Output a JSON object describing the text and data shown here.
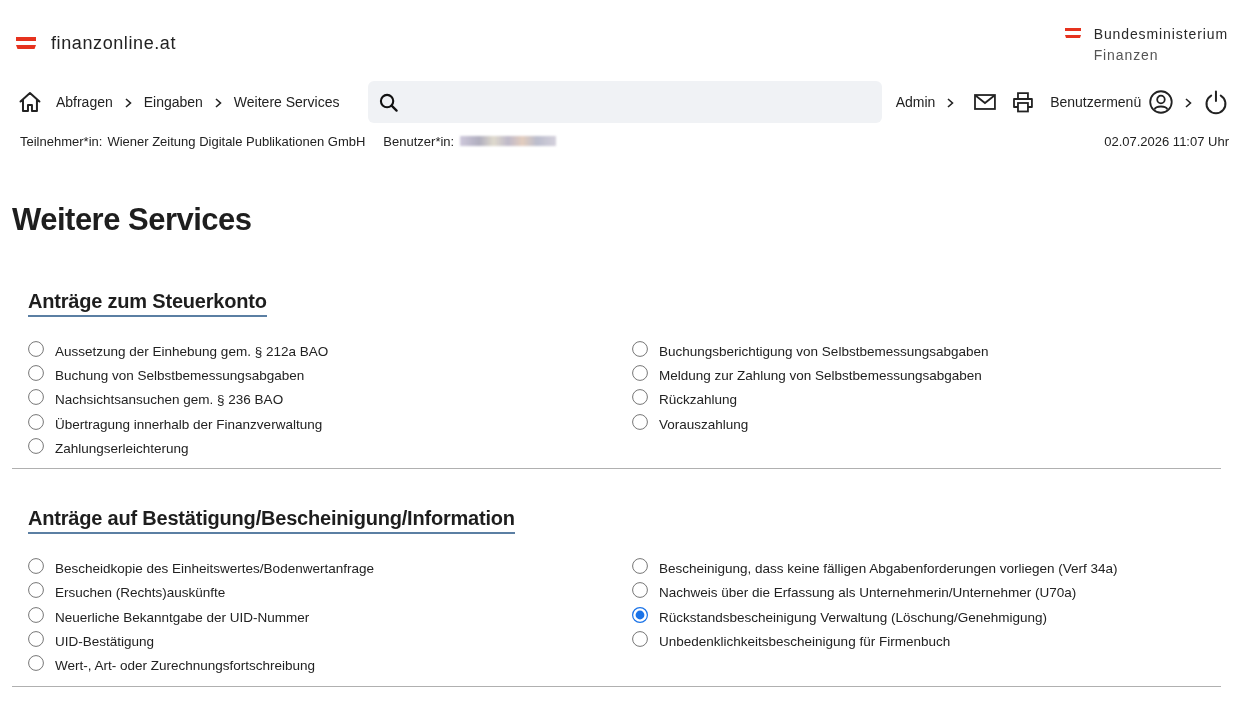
{
  "header": {
    "logo_text": "finanzonline.at",
    "ministry_lines": [
      "Bundesministerium",
      "Finanzen"
    ]
  },
  "nav": {
    "breadcrumbs": [
      "Abfragen",
      "Eingaben",
      "Weitere Services"
    ],
    "admin_link": "Admin",
    "user_menu": "Benutzermenü"
  },
  "info_bar": {
    "participant_label": "Teilnehmer*in:",
    "participant": "Wiener Zeitung Digitale Publikationen GmbH",
    "user_label": "Benutzer*in:",
    "datetime": "02.07.2026 11:07 Uhr"
  },
  "page_title": "Weitere Services",
  "sections": [
    {
      "title": "Anträge zum Steuerkonto",
      "columns": [
        [
          {
            "label": "Aussetzung der Einhebung gem. § 212a BAO",
            "selected": false
          },
          {
            "label": "Buchung von Selbstbemessungsabgaben",
            "selected": false
          },
          {
            "label": "Nachsichtsansuchen gem. § 236 BAO",
            "selected": false
          },
          {
            "label": "Übertragung innerhalb der Finanzverwaltung",
            "selected": false
          },
          {
            "label": "Zahlungserleichterung",
            "selected": false
          }
        ],
        [
          {
            "label": "Buchungsberichtigung von Selbstbemessungsabgaben",
            "selected": false
          },
          {
            "label": "Meldung zur Zahlung von Selbstbemessungsabgaben",
            "selected": false
          },
          {
            "label": "Rückzahlung",
            "selected": false
          },
          {
            "label": "Vorauszahlung",
            "selected": false
          }
        ]
      ]
    },
    {
      "title": "Anträge auf Bestätigung/Bescheinigung/Information",
      "columns": [
        [
          {
            "label": "Bescheidkopie des Einheitswertes/Bodenwertanfrage",
            "selected": false
          },
          {
            "label": "Ersuchen (Rechts)auskünfte",
            "selected": false
          },
          {
            "label": "Neuerliche Bekanntgabe der UID-Nummer",
            "selected": false
          },
          {
            "label": "UID-Bestätigung",
            "selected": false
          },
          {
            "label": "Wert-, Art- oder Zurechnungsfortschreibung",
            "selected": false
          }
        ],
        [
          {
            "label": "Bescheinigung, dass keine fälligen Abgabenforderungen vorliegen (Verf 34a)",
            "selected": false
          },
          {
            "label": "Nachweis über die Erfassung als Unternehmerin/Unternehmer (U70a)",
            "selected": false
          },
          {
            "label": "Rückstandsbescheinigung Verwaltung (Löschung/Genehmigung)",
            "selected": true
          },
          {
            "label": "Unbedenklichkeitsbescheinigung für Firmenbuch",
            "selected": false
          }
        ]
      ]
    }
  ]
}
